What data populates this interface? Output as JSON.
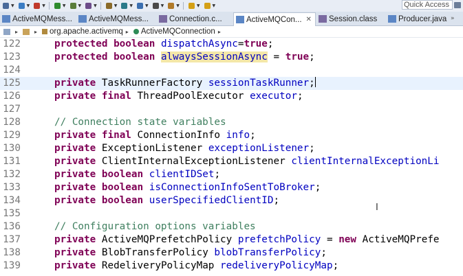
{
  "toolbar": {
    "quick_access": "Quick Access",
    "icons": [
      {
        "name": "gear-icon",
        "color": "#4a6a9a"
      },
      {
        "name": "new-icon",
        "color": "#3b7dc4"
      },
      {
        "name": "stop-icon",
        "color": "#c0392b"
      },
      {
        "name": "run-icon",
        "color": "#2e8b2e"
      },
      {
        "name": "debug-icon",
        "color": "#5a7d3a"
      },
      {
        "name": "open-type-icon",
        "color": "#6d4c8a"
      },
      {
        "name": "search-icon",
        "color": "#8a6a2a"
      },
      {
        "name": "pin-icon",
        "color": "#2a7a8a"
      },
      {
        "name": "annotation-icon",
        "color": "#3b6fb0"
      },
      {
        "name": "paragraph-icon",
        "color": "#4a4a4a"
      },
      {
        "name": "edit-icon",
        "color": "#b07a2a"
      },
      {
        "name": "nav-back-icon",
        "color": "#d4a017"
      },
      {
        "name": "nav-forward-icon",
        "color": "#d4a017"
      }
    ]
  },
  "tabs": [
    {
      "label": "ActiveMQMess...",
      "icon": "java-file-icon",
      "active": false
    },
    {
      "label": "ActiveMQMess...",
      "icon": "java-file-icon",
      "active": false
    },
    {
      "label": "Connection.c...",
      "icon": "class-file-icon",
      "active": false
    },
    {
      "label": "ActiveMQCon...",
      "icon": "java-file-icon",
      "active": true
    },
    {
      "label": "Session.class",
      "icon": "class-file-icon",
      "active": false
    },
    {
      "label": "Producer.java",
      "icon": "java-file-icon",
      "active": false
    }
  ],
  "tab_close": "✕",
  "tab_overflow": "»",
  "breadcrumb": {
    "package": "org.apache.activemq",
    "class_name": "ActiveMQConnection",
    "separator": "▸"
  },
  "editor": {
    "current_line": "125",
    "lines": [
      {
        "n": "122",
        "tokens": [
          [
            "kw",
            "protected"
          ],
          [
            "t",
            " "
          ],
          [
            "kw",
            "boolean"
          ],
          [
            "t",
            " "
          ],
          [
            "field",
            "dispatchAsync"
          ],
          [
            "t",
            "="
          ],
          [
            "kw",
            "true"
          ],
          [
            "t",
            ";"
          ]
        ]
      },
      {
        "n": "123",
        "tokens": [
          [
            "kw",
            "protected"
          ],
          [
            "t",
            " "
          ],
          [
            "kw",
            "boolean"
          ],
          [
            "t",
            " "
          ],
          [
            "field-hl",
            "alwaysSessionAsync"
          ],
          [
            "t",
            " = "
          ],
          [
            "kw",
            "true"
          ],
          [
            "t",
            ";"
          ]
        ]
      },
      {
        "n": "124",
        "tokens": []
      },
      {
        "n": "125",
        "tokens": [
          [
            "kw",
            "private"
          ],
          [
            "t",
            " TaskRunnerFactory "
          ],
          [
            "field",
            "sessionTaskRunner"
          ],
          [
            "t",
            ";"
          ],
          [
            "caret",
            ""
          ]
        ]
      },
      {
        "n": "126",
        "tokens": [
          [
            "kw",
            "private"
          ],
          [
            "t",
            " "
          ],
          [
            "kw",
            "final"
          ],
          [
            "t",
            " ThreadPoolExecutor "
          ],
          [
            "field",
            "executor"
          ],
          [
            "t",
            ";"
          ]
        ]
      },
      {
        "n": "127",
        "tokens": []
      },
      {
        "n": "128",
        "tokens": [
          [
            "cm",
            "// Connection state variables"
          ]
        ]
      },
      {
        "n": "129",
        "tokens": [
          [
            "kw",
            "private"
          ],
          [
            "t",
            " "
          ],
          [
            "kw",
            "final"
          ],
          [
            "t",
            " ConnectionInfo "
          ],
          [
            "field",
            "info"
          ],
          [
            "t",
            ";"
          ]
        ]
      },
      {
        "n": "130",
        "tokens": [
          [
            "kw",
            "private"
          ],
          [
            "t",
            " ExceptionListener "
          ],
          [
            "field",
            "exceptionListener"
          ],
          [
            "t",
            ";"
          ]
        ]
      },
      {
        "n": "131",
        "tokens": [
          [
            "kw",
            "private"
          ],
          [
            "t",
            " ClientInternalExceptionListener "
          ],
          [
            "field",
            "clientInternalExceptionLi"
          ]
        ]
      },
      {
        "n": "132",
        "tokens": [
          [
            "kw",
            "private"
          ],
          [
            "t",
            " "
          ],
          [
            "kw",
            "boolean"
          ],
          [
            "t",
            " "
          ],
          [
            "field",
            "clientIDSet"
          ],
          [
            "t",
            ";"
          ]
        ]
      },
      {
        "n": "133",
        "tokens": [
          [
            "kw",
            "private"
          ],
          [
            "t",
            " "
          ],
          [
            "kw",
            "boolean"
          ],
          [
            "t",
            " "
          ],
          [
            "field",
            "isConnectionInfoSentToBroker"
          ],
          [
            "t",
            ";"
          ]
        ]
      },
      {
        "n": "134",
        "tokens": [
          [
            "kw",
            "private"
          ],
          [
            "t",
            " "
          ],
          [
            "kw",
            "boolean"
          ],
          [
            "t",
            " "
          ],
          [
            "field",
            "userSpecifiedClientID"
          ],
          [
            "t",
            ";"
          ]
        ]
      },
      {
        "n": "135",
        "tokens": []
      },
      {
        "n": "136",
        "tokens": [
          [
            "cm",
            "// Configuration options variables"
          ]
        ]
      },
      {
        "n": "137",
        "tokens": [
          [
            "kw",
            "private"
          ],
          [
            "t",
            " ActiveMQPrefetchPolicy "
          ],
          [
            "field",
            "prefetchPolicy"
          ],
          [
            "t",
            " = "
          ],
          [
            "kw",
            "new"
          ],
          [
            "t",
            " ActiveMQPrefe"
          ]
        ]
      },
      {
        "n": "138",
        "tokens": [
          [
            "kw",
            "private"
          ],
          [
            "t",
            " BlobTransferPolicy "
          ],
          [
            "field",
            "blobTransferPolicy"
          ],
          [
            "t",
            ";"
          ]
        ]
      },
      {
        "n": "139",
        "tokens": [
          [
            "kw",
            "private"
          ],
          [
            "t",
            " RedeliveryPolicyMap "
          ],
          [
            "field",
            "redeliveryPolicyMap"
          ],
          [
            "t",
            ";"
          ]
        ]
      }
    ]
  },
  "colors": {
    "keyword": "#7f0055",
    "field": "#0000c0",
    "comment": "#3f7f5f",
    "highlight": "#f4e7a8",
    "current_line_bg": "#e8f2fe",
    "line_number": "#787878"
  }
}
